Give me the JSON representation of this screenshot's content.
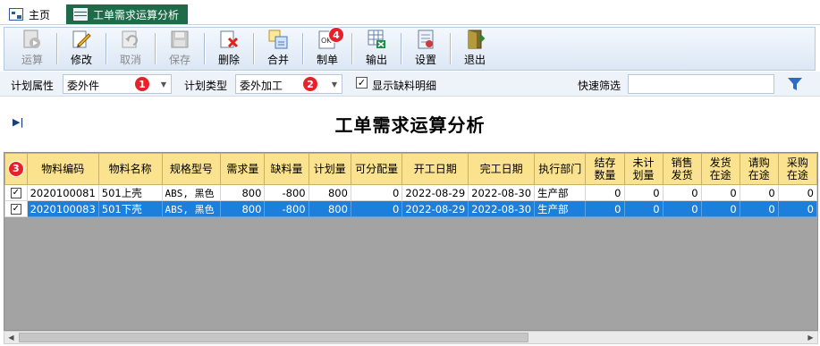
{
  "tabs": [
    {
      "label": "主页"
    },
    {
      "label": "工单需求运算分析"
    }
  ],
  "toolbar": {
    "buttons": [
      {
        "label": "运算",
        "icon": "play-icon",
        "enabled": false
      },
      {
        "label": "修改",
        "icon": "edit-icon",
        "enabled": true
      },
      {
        "label": "取消",
        "icon": "undo-icon",
        "enabled": false
      },
      {
        "label": "保存",
        "icon": "save-icon",
        "enabled": false
      },
      {
        "label": "删除",
        "icon": "delete-icon",
        "enabled": true
      },
      {
        "label": "合并",
        "icon": "merge-icon",
        "enabled": true
      },
      {
        "label": "制单",
        "icon": "ok-document-icon",
        "enabled": true
      },
      {
        "label": "输出",
        "icon": "export-icon",
        "enabled": true
      },
      {
        "label": "设置",
        "icon": "settings-icon",
        "enabled": true
      },
      {
        "label": "退出",
        "icon": "exit-door-icon",
        "enabled": true
      }
    ]
  },
  "filters": {
    "plan_attr_label": "计划属性",
    "plan_attr_value": "委外件",
    "plan_type_label": "计划类型",
    "plan_type_value": "委外加工",
    "show_shortage_label": "显示缺料明细",
    "show_shortage_checked": true,
    "quick_filter_label": "快速筛选",
    "quick_filter_value": ""
  },
  "badges": {
    "b1": "1",
    "b2": "2",
    "b3": "3",
    "b4": "4"
  },
  "report_title": "工单需求运算分析",
  "expander_glyph": "▶|",
  "table": {
    "columns": [
      "",
      "物料编码",
      "物料名称",
      "规格型号",
      "需求量",
      "缺料量",
      "计划量",
      "可分配量",
      "开工日期",
      "完工日期",
      "执行部门",
      "结存\n数量",
      "未计\n划量",
      "销售\n发货",
      "发货\n在途",
      "请购\n在途",
      "采购\n在途"
    ],
    "rows": [
      {
        "checked": true,
        "selected": false,
        "cells": [
          "2020100081",
          "501上壳",
          "ABS, 黑色",
          "800",
          "-800",
          "800",
          "0",
          "2022-08-29",
          "2022-08-30",
          "生产部",
          "0",
          "0",
          "0",
          "0",
          "0",
          "0"
        ]
      },
      {
        "checked": true,
        "selected": true,
        "cells": [
          "2020100083",
          "501下壳",
          "ABS, 黑色",
          "800",
          "-800",
          "800",
          "0",
          "2022-08-29",
          "2022-08-30",
          "生产部",
          "0",
          "0",
          "0",
          "0",
          "0",
          "0"
        ]
      }
    ]
  },
  "colors": {
    "tab_active_bg": "#1e6b49",
    "header_bg": "#fbe28f",
    "selected_row_bg": "#1c7fdb",
    "badge_red": "#e8202a",
    "grid_empty_bg": "#a3a3a3"
  }
}
